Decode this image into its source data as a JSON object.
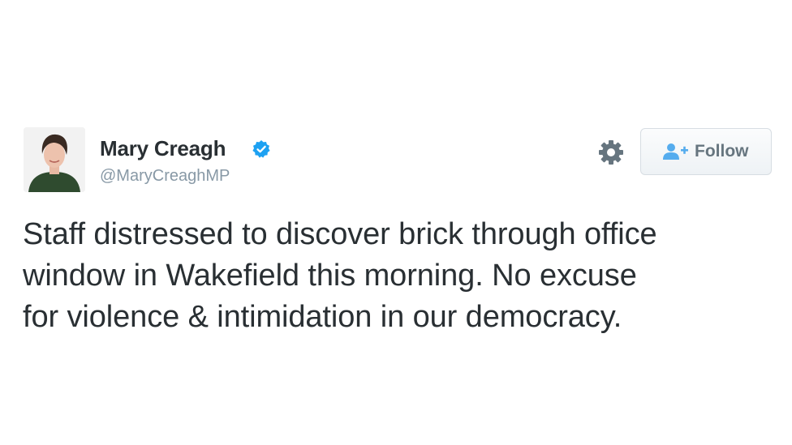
{
  "tweet": {
    "author": {
      "display_name": "Mary Creagh",
      "handle": "@MaryCreaghMP",
      "verified": true,
      "avatar_icon": "profile-photo"
    },
    "actions": {
      "settings_icon": "gear-icon",
      "follow_label": "Follow",
      "follow_icon": "add-user-icon"
    },
    "text": "Staff distressed to discover brick through office\nwindow in Wakefield this morning. No excuse\nfor violence & intimidation in our democracy."
  },
  "colors": {
    "text": "#292f33",
    "handle": "#8899a6",
    "verified": "#1da1f2",
    "follow_text": "#66757f",
    "follow_icon": "#55acee",
    "gear": "#66757f"
  }
}
